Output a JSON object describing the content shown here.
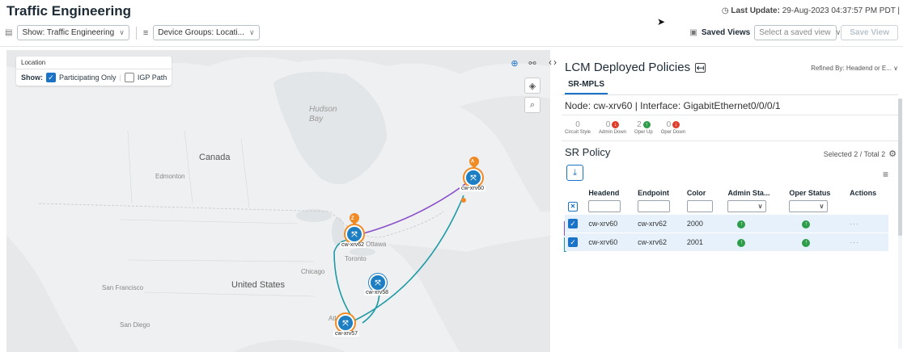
{
  "header": {
    "title": "Traffic Engineering",
    "last_update_label": "Last Update:",
    "last_update_value": "29-Aug-2023 04:37:57 PM PDT |"
  },
  "toolbar": {
    "show_select": "Show: Traffic Engineering",
    "device_groups_select": "Device Groups: Locati...",
    "saved_views_label": "Saved Views",
    "saved_view_placeholder": "Select a saved view",
    "save_view_label": "Save View"
  },
  "map": {
    "location_header": "Location",
    "show_label": "Show:",
    "participating_only_label": "Participating Only",
    "igp_path_label": "IGP Path",
    "participating_only_checked": true,
    "igp_path_checked": false,
    "geo_labels": {
      "hudson_bay": "Hudson\nBay",
      "canada": "Canada",
      "united_states": "United States",
      "edmonton": "Edmonton",
      "ottawa": "Ottawa",
      "toronto": "Toronto",
      "chicago": "Chicago",
      "san_francisco": "San Francisco",
      "san_diego": "San Diego",
      "atlanta": "Atlanta"
    },
    "nodes": [
      {
        "name": "cw-xrv60",
        "badge": "A"
      },
      {
        "name": "cw-xrv62",
        "badge": "Z"
      },
      {
        "name": "cw-xrv58"
      },
      {
        "name": "cw-xrv57"
      }
    ],
    "colors": {
      "policy_purple": "#8a4fc9",
      "policy_teal": "#1e9aa6",
      "node_blue": "#1d7ec2",
      "pin_orange": "#f08a24"
    }
  },
  "panel": {
    "title": "LCM Deployed Policies",
    "refined_by": "Refined By: Headend or E...",
    "tab": "SR-MPLS",
    "node_info": "Node: cw-xrv60 | Interface: GigabitEthernet0/0/0/1",
    "stats": [
      {
        "value": "0",
        "label": "Circuit Style",
        "icon": ""
      },
      {
        "value": "0",
        "label": "Admin Down",
        "icon": "down-red"
      },
      {
        "value": "2",
        "label": "Oper Up",
        "icon": "up-green"
      },
      {
        "value": "0",
        "label": "Oper Down",
        "icon": "down-red"
      }
    ],
    "sr_policy_title": "SR Policy",
    "selected_text": "Selected 2 / Total 2",
    "columns": [
      "Headend",
      "Endpoint",
      "Color",
      "Admin Sta...",
      "Oper Status",
      "Actions"
    ],
    "rows": [
      {
        "headend": "cw-xrv60",
        "endpoint": "cw-xrv62",
        "color": "2000",
        "admin": "up",
        "oper": "up",
        "actions": "···",
        "bar": "#8a4fc9"
      },
      {
        "headend": "cw-xrv60",
        "endpoint": "cw-xrv62",
        "color": "2001",
        "admin": "up",
        "oper": "up",
        "actions": "···",
        "bar": "#1e9aa6"
      }
    ]
  }
}
